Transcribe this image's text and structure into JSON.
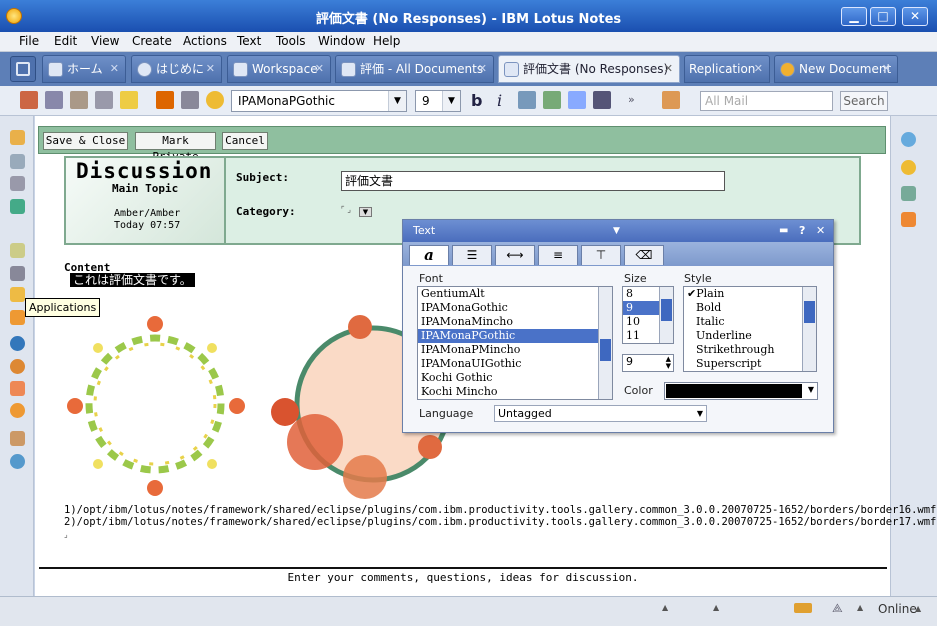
{
  "window": {
    "title": "評価文書 (No Responses) - IBM Lotus Notes",
    "min": "▁",
    "max": "□",
    "close": "✕"
  },
  "menu": [
    "File",
    "Edit",
    "View",
    "Create",
    "Actions",
    "Text",
    "Tools",
    "Window",
    "Help"
  ],
  "tabs": [
    {
      "label": "ホーム"
    },
    {
      "label": "はじめに"
    },
    {
      "label": "Workspace"
    },
    {
      "label": "評価 - All Documents"
    },
    {
      "label": "評価文書 (No Responses)"
    },
    {
      "label": "Replication"
    },
    {
      "label": "New Document"
    }
  ],
  "toolbar": {
    "font": "IPAMonaPGothic",
    "size": "9",
    "search_placeholder": "All Mail",
    "search_label": "Search"
  },
  "actions": {
    "save_close": "Save & Close",
    "mark_private": "Mark Private",
    "cancel": "Cancel"
  },
  "form": {
    "logo_title": "Discussion",
    "logo_subtitle": "Main Topic",
    "author": "Amber/Amber",
    "date": "Today 07:57",
    "subject_label": "Subject:",
    "subject_value": "評価文書",
    "category_label": "Category:",
    "content_label": "Content",
    "content_text": "これは評価文書です。",
    "paths": [
      "1)/opt/ibm/lotus/notes/framework/shared/eclipse/plugins/com.ibm.productivity.tools.gallery.common_3.0.0.20070725-1652/borders/border16.wmf",
      "2)/opt/ibm/lotus/notes/framework/shared/eclipse/plugins/com.ibm.productivity.tools.gallery.common_3.0.0.20070725-1652/borders/border17.wmf"
    ],
    "footer": "Enter your comments, questions, ideas for discussion."
  },
  "tooltip": "Applications",
  "text_panel": {
    "title": "Text",
    "font_label": "Font",
    "size_label": "Size",
    "style_label": "Style",
    "color_label": "Color",
    "language_label": "Language",
    "language_value": "Untagged",
    "fonts": [
      "GentiumAlt",
      "IPAMonaGothic",
      "IPAMonaMincho",
      "IPAMonaPGothic",
      "IPAMonaPMincho",
      "IPAMonaUIGothic",
      "Kochi Gothic",
      "Kochi Mincho"
    ],
    "selected_font": "IPAMonaPGothic",
    "sizes": [
      "8",
      "9",
      "10",
      "11"
    ],
    "selected_size": "9",
    "size_value": "9",
    "styles": [
      "Plain",
      "Bold",
      "Italic",
      "Underline",
      "Strikethrough",
      "Superscript"
    ],
    "checked_style": "Plain",
    "color_value": "#000000",
    "tab_glyph": "a"
  },
  "status": {
    "online": "Online"
  },
  "colors": {
    "accent": "#2f67c8",
    "form_green": "#8fbf9f",
    "selection": "#4a72c8"
  }
}
